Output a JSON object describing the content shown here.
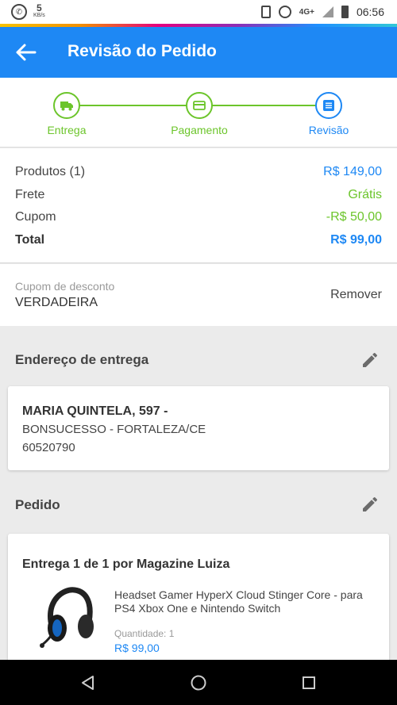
{
  "status_bar": {
    "data_speed_value": "5",
    "data_speed_unit": "KB/s",
    "network": "4G+",
    "time": "06:56"
  },
  "app_bar": {
    "title": "Revisão do Pedido",
    "color": "#1e88f4"
  },
  "stepper": {
    "steps": [
      {
        "label": "Entrega",
        "icon": "truck-icon",
        "state": "done"
      },
      {
        "label": "Pagamento",
        "icon": "card-icon",
        "state": "done"
      },
      {
        "label": "Revisão",
        "icon": "list-icon",
        "state": "current"
      }
    ],
    "done_color": "#6cc52b",
    "current_color": "#1e88f4"
  },
  "summary": {
    "products_label": "Produtos (1)",
    "products_value": "R$ 149,00",
    "shipping_label": "Frete",
    "shipping_value": "Grátis",
    "coupon_label": "Cupom",
    "coupon_value": "-R$ 50,00",
    "total_label": "Total",
    "total_value": "R$ 99,00"
  },
  "coupon": {
    "label": "Cupom de desconto",
    "value": "VERDADEIRA",
    "remove_label": "Remover"
  },
  "address": {
    "section_title": "Endereço de entrega",
    "name": "MARIA QUINTELA, 597 -",
    "line1": "BONSUCESSO - FORTALEZA/CE",
    "zip": "60520790"
  },
  "order": {
    "section_title": "Pedido",
    "delivery_title": "Entrega 1 de 1 por Magazine Luiza",
    "product_name": "Headset Gamer HyperX Cloud Stinger Core - para PS4 Xbox One e Nintendo Switch",
    "quantity_label": "Quantidade:",
    "quantity_value": "1",
    "price": "R$ 99,00"
  }
}
